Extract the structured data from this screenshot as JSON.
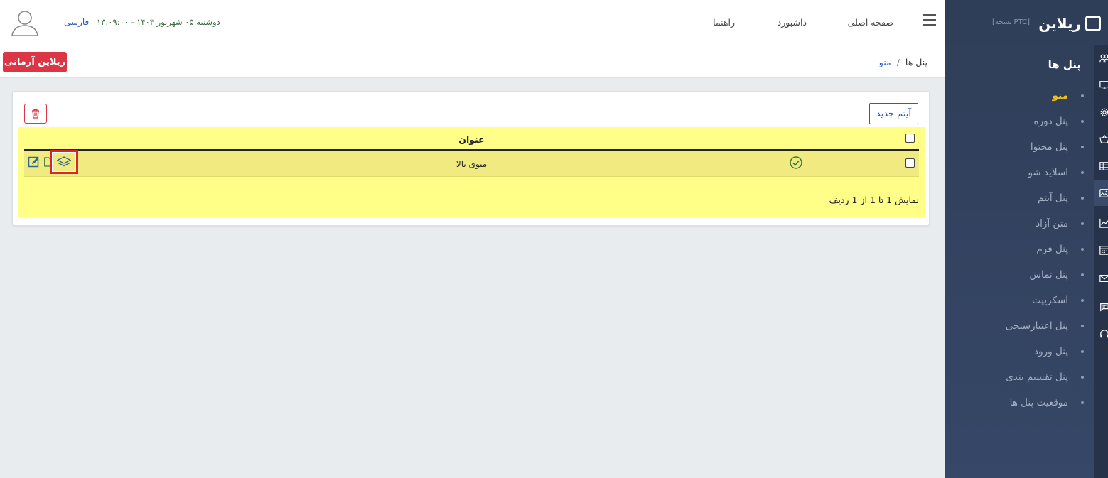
{
  "app": {
    "logo_text": "ریلاین",
    "version": "[نسخه PTC]",
    "brand_button": "ریلاین آرمانی",
    "accent_color": "#f2c21b",
    "danger_color": "#dc3545",
    "link_color": "#2a5bc4"
  },
  "topbar": {
    "nav": [
      "صفحه اصلی",
      "داشبورد",
      "راهنما"
    ],
    "datetime": "دوشنبه ۰۵ شهریور ۱۴۰۳ - ۱۳:۰۹:۰۰",
    "language": "فارسی"
  },
  "breadcrumb": {
    "items": [
      "پنل ها",
      "منو"
    ],
    "separator": "/"
  },
  "sidebar": {
    "title": "پنل ها",
    "items": [
      {
        "label": "منو",
        "active": true
      },
      {
        "label": "پنل دوره"
      },
      {
        "label": "پنل محتوا"
      },
      {
        "label": "اسلاید شو"
      },
      {
        "label": "پنل آیتم"
      },
      {
        "label": "متن آزاد"
      },
      {
        "label": "پنل فرم"
      },
      {
        "label": "پنل تماس"
      },
      {
        "label": "اسکریپت"
      },
      {
        "label": "پنل اعتبارسنجی"
      },
      {
        "label": "پنل ورود"
      },
      {
        "label": "پنل تقسیم بندی"
      },
      {
        "label": "موقعیت پنل ها"
      }
    ],
    "rail_icons": [
      "users-icon",
      "monitor-icon",
      "gear-icon",
      "basket-icon",
      "table-icon",
      "image-icon",
      "chart-icon",
      "calendar-icon",
      "mail-icon",
      "chat-icon",
      "headset-icon"
    ]
  },
  "card": {
    "new_item_label": "آیتم جدید",
    "table": {
      "column_title": "عنوان",
      "rows": [
        {
          "title": "منوی بالا",
          "status": "active"
        }
      ],
      "summary": "نمایش 1 تا 1 از 1 ردیف"
    }
  }
}
